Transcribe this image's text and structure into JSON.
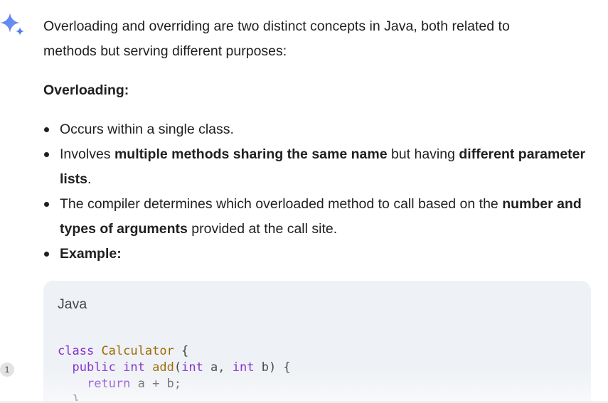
{
  "response": {
    "intro_line1": "Overloading and overriding are two distinct concepts in Java, both related to",
    "intro_line2": "methods but serving different purposes:",
    "section_heading": "Overloading:",
    "bullet1": "Occurs within a single class.",
    "bullet2": {
      "t1": "Involves ",
      "b1": "multiple methods sharing the same name",
      "t2": " but having ",
      "b2": "different parameter lists",
      "t3": "."
    },
    "bullet3": {
      "t1": "The compiler determines which overloaded method to call based on the ",
      "b1": "number and types of arguments",
      "t2": " provided at the call site."
    },
    "bullet4": "Example:"
  },
  "code": {
    "language": "Java",
    "line1": {
      "kw": "class",
      "name": "Calculator",
      "rest": " {"
    },
    "line2": {
      "kw1": "public",
      "kw2": "int",
      "fn": "add",
      "p1": "(",
      "kw3": "int",
      "p2": " a, ",
      "kw4": "int",
      "p3": " b) {"
    },
    "line3": {
      "kw": "return",
      "rest": " a + b;"
    },
    "line4": "}"
  },
  "badge": {
    "count": "1"
  },
  "colors": {
    "keyword": "#8430ce",
    "identifier": "#9e6a03",
    "code_bg": "#eef1f5",
    "spark_blue": "#4f7ef0",
    "spark_purple": "#9b72cb"
  },
  "icons": {
    "spark": "gemini-spark-icon"
  }
}
